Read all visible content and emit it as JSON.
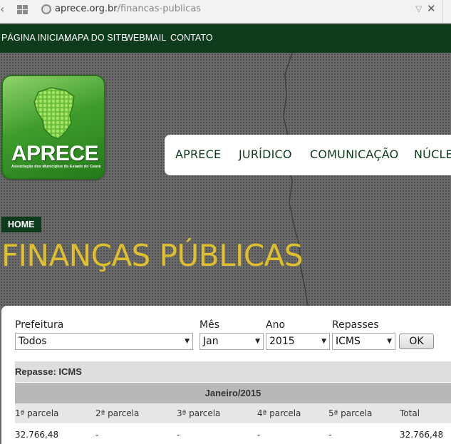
{
  "browser": {
    "url_host": "aprece.org.br",
    "url_path": "/financas-publicas"
  },
  "topnav": [
    "PÁGINA INICIAL",
    "MAPA DO SITE",
    "WEBMAIL",
    "CONTATO"
  ],
  "logo": {
    "name": "APRECE",
    "subtitle": "Associação dos Municípios do Estado do Ceará"
  },
  "mainnav": [
    "APRECE",
    "JURÍDICO",
    "COMUNICAÇÃO",
    "NÚCLEO"
  ],
  "breadcrumb": "HOME",
  "page_title": "FINANÇAS PÚBLICAS",
  "filters": {
    "prefeitura_label": "Prefeitura",
    "prefeitura_value": "Todos",
    "mes_label": "Mês",
    "mes_value": "Jan",
    "ano_label": "Ano",
    "ano_value": "2015",
    "repasses_label": "Repasses",
    "repasses_value": "ICMS",
    "ok_label": "OK"
  },
  "table": {
    "repasse_caption": "Repasse: ICMS",
    "period": "Janeiro/2015",
    "headers": [
      "1ª parcela",
      "2ª parcela",
      "3ª parcela",
      "4ª parcela",
      "5ª parcela",
      "Total"
    ],
    "values": [
      "32.766,48",
      "-",
      "-",
      "-",
      "-",
      "32.766,48"
    ]
  },
  "colors": {
    "brand_dark_green": "#0f3b1d",
    "title_yellow": "#e0bf2e"
  }
}
